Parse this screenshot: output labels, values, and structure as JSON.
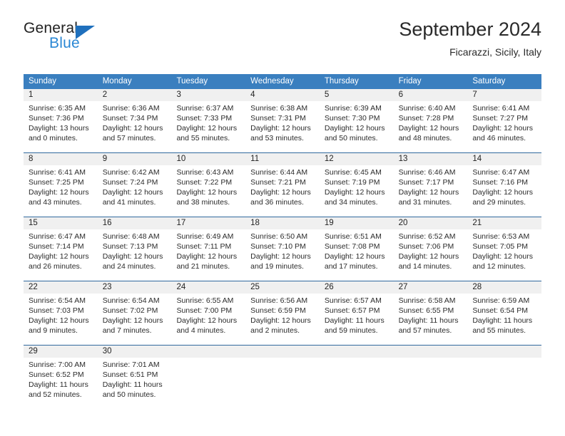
{
  "logo": {
    "word1": "General",
    "word2": "Blue",
    "triangle_color": "#1f70bd",
    "blue_color": "#2a87d4"
  },
  "header": {
    "month_title": "September 2024",
    "location": "Ficarazzi, Sicily, Italy",
    "accent_color": "#3a7fbf",
    "band_color": "#f0f0f0",
    "rule_color": "#31699e"
  },
  "weekday_headers": [
    "Sunday",
    "Monday",
    "Tuesday",
    "Wednesday",
    "Thursday",
    "Friday",
    "Saturday"
  ],
  "labels": {
    "sunrise": "Sunrise:",
    "sunset": "Sunset:",
    "daylight": "Daylight:"
  },
  "weeks": [
    [
      {
        "day": "1",
        "sunrise": "Sunrise: 6:35 AM",
        "sunset": "Sunset: 7:36 PM",
        "daylight1": "Daylight: 13 hours",
        "daylight2": "and 0 minutes."
      },
      {
        "day": "2",
        "sunrise": "Sunrise: 6:36 AM",
        "sunset": "Sunset: 7:34 PM",
        "daylight1": "Daylight: 12 hours",
        "daylight2": "and 57 minutes."
      },
      {
        "day": "3",
        "sunrise": "Sunrise: 6:37 AM",
        "sunset": "Sunset: 7:33 PM",
        "daylight1": "Daylight: 12 hours",
        "daylight2": "and 55 minutes."
      },
      {
        "day": "4",
        "sunrise": "Sunrise: 6:38 AM",
        "sunset": "Sunset: 7:31 PM",
        "daylight1": "Daylight: 12 hours",
        "daylight2": "and 53 minutes."
      },
      {
        "day": "5",
        "sunrise": "Sunrise: 6:39 AM",
        "sunset": "Sunset: 7:30 PM",
        "daylight1": "Daylight: 12 hours",
        "daylight2": "and 50 minutes."
      },
      {
        "day": "6",
        "sunrise": "Sunrise: 6:40 AM",
        "sunset": "Sunset: 7:28 PM",
        "daylight1": "Daylight: 12 hours",
        "daylight2": "and 48 minutes."
      },
      {
        "day": "7",
        "sunrise": "Sunrise: 6:41 AM",
        "sunset": "Sunset: 7:27 PM",
        "daylight1": "Daylight: 12 hours",
        "daylight2": "and 46 minutes."
      }
    ],
    [
      {
        "day": "8",
        "sunrise": "Sunrise: 6:41 AM",
        "sunset": "Sunset: 7:25 PM",
        "daylight1": "Daylight: 12 hours",
        "daylight2": "and 43 minutes."
      },
      {
        "day": "9",
        "sunrise": "Sunrise: 6:42 AM",
        "sunset": "Sunset: 7:24 PM",
        "daylight1": "Daylight: 12 hours",
        "daylight2": "and 41 minutes."
      },
      {
        "day": "10",
        "sunrise": "Sunrise: 6:43 AM",
        "sunset": "Sunset: 7:22 PM",
        "daylight1": "Daylight: 12 hours",
        "daylight2": "and 38 minutes."
      },
      {
        "day": "11",
        "sunrise": "Sunrise: 6:44 AM",
        "sunset": "Sunset: 7:21 PM",
        "daylight1": "Daylight: 12 hours",
        "daylight2": "and 36 minutes."
      },
      {
        "day": "12",
        "sunrise": "Sunrise: 6:45 AM",
        "sunset": "Sunset: 7:19 PM",
        "daylight1": "Daylight: 12 hours",
        "daylight2": "and 34 minutes."
      },
      {
        "day": "13",
        "sunrise": "Sunrise: 6:46 AM",
        "sunset": "Sunset: 7:17 PM",
        "daylight1": "Daylight: 12 hours",
        "daylight2": "and 31 minutes."
      },
      {
        "day": "14",
        "sunrise": "Sunrise: 6:47 AM",
        "sunset": "Sunset: 7:16 PM",
        "daylight1": "Daylight: 12 hours",
        "daylight2": "and 29 minutes."
      }
    ],
    [
      {
        "day": "15",
        "sunrise": "Sunrise: 6:47 AM",
        "sunset": "Sunset: 7:14 PM",
        "daylight1": "Daylight: 12 hours",
        "daylight2": "and 26 minutes."
      },
      {
        "day": "16",
        "sunrise": "Sunrise: 6:48 AM",
        "sunset": "Sunset: 7:13 PM",
        "daylight1": "Daylight: 12 hours",
        "daylight2": "and 24 minutes."
      },
      {
        "day": "17",
        "sunrise": "Sunrise: 6:49 AM",
        "sunset": "Sunset: 7:11 PM",
        "daylight1": "Daylight: 12 hours",
        "daylight2": "and 21 minutes."
      },
      {
        "day": "18",
        "sunrise": "Sunrise: 6:50 AM",
        "sunset": "Sunset: 7:10 PM",
        "daylight1": "Daylight: 12 hours",
        "daylight2": "and 19 minutes."
      },
      {
        "day": "19",
        "sunrise": "Sunrise: 6:51 AM",
        "sunset": "Sunset: 7:08 PM",
        "daylight1": "Daylight: 12 hours",
        "daylight2": "and 17 minutes."
      },
      {
        "day": "20",
        "sunrise": "Sunrise: 6:52 AM",
        "sunset": "Sunset: 7:06 PM",
        "daylight1": "Daylight: 12 hours",
        "daylight2": "and 14 minutes."
      },
      {
        "day": "21",
        "sunrise": "Sunrise: 6:53 AM",
        "sunset": "Sunset: 7:05 PM",
        "daylight1": "Daylight: 12 hours",
        "daylight2": "and 12 minutes."
      }
    ],
    [
      {
        "day": "22",
        "sunrise": "Sunrise: 6:54 AM",
        "sunset": "Sunset: 7:03 PM",
        "daylight1": "Daylight: 12 hours",
        "daylight2": "and 9 minutes."
      },
      {
        "day": "23",
        "sunrise": "Sunrise: 6:54 AM",
        "sunset": "Sunset: 7:02 PM",
        "daylight1": "Daylight: 12 hours",
        "daylight2": "and 7 minutes."
      },
      {
        "day": "24",
        "sunrise": "Sunrise: 6:55 AM",
        "sunset": "Sunset: 7:00 PM",
        "daylight1": "Daylight: 12 hours",
        "daylight2": "and 4 minutes."
      },
      {
        "day": "25",
        "sunrise": "Sunrise: 6:56 AM",
        "sunset": "Sunset: 6:59 PM",
        "daylight1": "Daylight: 12 hours",
        "daylight2": "and 2 minutes."
      },
      {
        "day": "26",
        "sunrise": "Sunrise: 6:57 AM",
        "sunset": "Sunset: 6:57 PM",
        "daylight1": "Daylight: 11 hours",
        "daylight2": "and 59 minutes."
      },
      {
        "day": "27",
        "sunrise": "Sunrise: 6:58 AM",
        "sunset": "Sunset: 6:55 PM",
        "daylight1": "Daylight: 11 hours",
        "daylight2": "and 57 minutes."
      },
      {
        "day": "28",
        "sunrise": "Sunrise: 6:59 AM",
        "sunset": "Sunset: 6:54 PM",
        "daylight1": "Daylight: 11 hours",
        "daylight2": "and 55 minutes."
      }
    ],
    [
      {
        "day": "29",
        "sunrise": "Sunrise: 7:00 AM",
        "sunset": "Sunset: 6:52 PM",
        "daylight1": "Daylight: 11 hours",
        "daylight2": "and 52 minutes."
      },
      {
        "day": "30",
        "sunrise": "Sunrise: 7:01 AM",
        "sunset": "Sunset: 6:51 PM",
        "daylight1": "Daylight: 11 hours",
        "daylight2": "and 50 minutes."
      },
      {
        "day": "",
        "sunrise": "",
        "sunset": "",
        "daylight1": "",
        "daylight2": ""
      },
      {
        "day": "",
        "sunrise": "",
        "sunset": "",
        "daylight1": "",
        "daylight2": ""
      },
      {
        "day": "",
        "sunrise": "",
        "sunset": "",
        "daylight1": "",
        "daylight2": ""
      },
      {
        "day": "",
        "sunrise": "",
        "sunset": "",
        "daylight1": "",
        "daylight2": ""
      },
      {
        "day": "",
        "sunrise": "",
        "sunset": "",
        "daylight1": "",
        "daylight2": ""
      }
    ]
  ]
}
